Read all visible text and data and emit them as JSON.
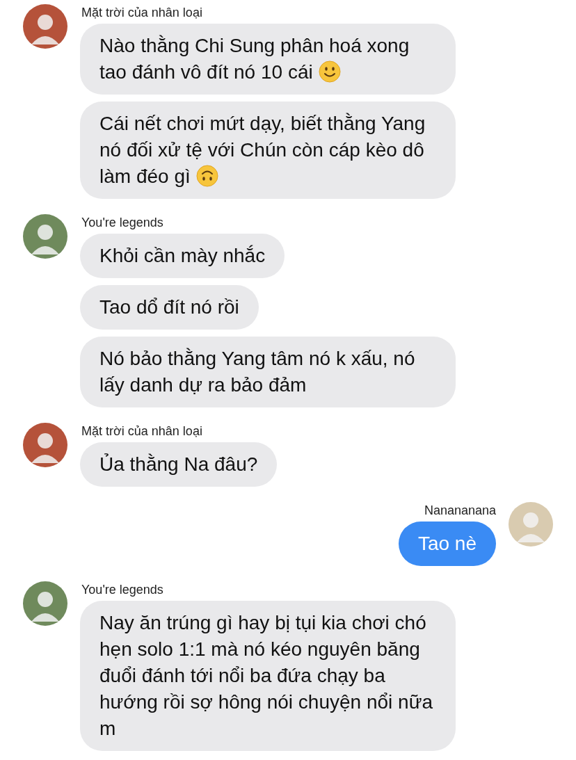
{
  "groups": [
    {
      "sender": "Mặt trời của nhân loại",
      "kind": "incoming",
      "color": "#b5523a",
      "messages": [
        {
          "text": "Nào thằng Chi Sung phân hoá xong tao đánh vô đít nó 10 cái",
          "kind": "smile"
        },
        {
          "text": "Cái nết chơi mứt dạy, biết thằng Yang nó đối xử tệ với Chún còn cáp kèo dô làm đéo gì",
          "kind": "upside_down"
        }
      ]
    },
    {
      "sender": "You're legends",
      "kind": "incoming",
      "color": "#6f8a5c",
      "messages": [
        {
          "text": "Khỏi cần mày nhắc"
        },
        {
          "text": "Tao dổ đít nó rồi"
        },
        {
          "text": "Nó bảo thằng Yang tâm nó k xấu, nó lấy danh dự ra bảo đảm"
        }
      ]
    },
    {
      "sender": "Mặt trời của nhân loại",
      "kind": "incoming",
      "color": "#b5523a",
      "messages": [
        {
          "text": "Ủa thằng Na đâu?"
        }
      ]
    },
    {
      "sender": "Nanananana",
      "kind": "outgoing",
      "color": "#d9cbb0",
      "messages": [
        {
          "text": "Tao nè"
        }
      ]
    },
    {
      "sender": "You're legends",
      "kind": "incoming",
      "color": "#6f8a5c",
      "messages": [
        {
          "text": "Nay ăn trúng gì hay bị tụi kia chơi chó hẹn solo 1:1 mà nó kéo nguyên băng đuổi đánh tới nổi ba đứa chạy ba hướng rồi sợ hông nói chuyện nổi nữa m"
        }
      ]
    }
  ]
}
